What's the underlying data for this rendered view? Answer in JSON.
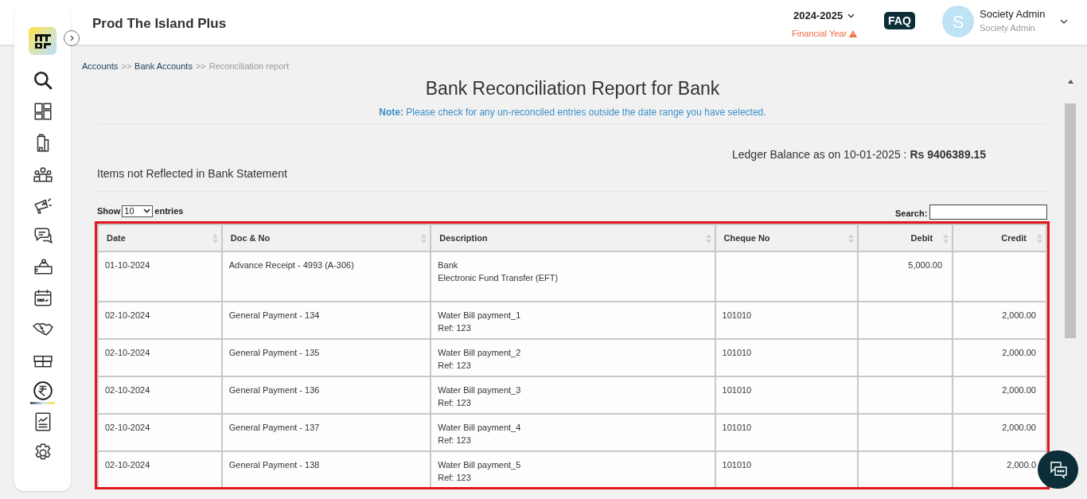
{
  "header": {
    "title": "Prod The Island Plus",
    "year": "2024-2025",
    "year_label": "Financial Year",
    "faq": "FAQ",
    "avatar": "S",
    "user_name": "Society Admin",
    "user_role": "Society Admin"
  },
  "sidebar": {
    "items": [
      {
        "selected": false
      },
      {
        "selected": false
      },
      {
        "selected": false
      },
      {
        "selected": false
      },
      {
        "selected": false
      },
      {
        "selected": false
      },
      {
        "selected": false
      },
      {
        "selected": false
      },
      {
        "selected": false
      },
      {
        "selected": false
      },
      {
        "selected": true
      },
      {
        "selected": false
      },
      {
        "selected": false
      }
    ]
  },
  "breadcrumb": [
    {
      "label": "Accounts",
      "link": true
    },
    {
      "label": "Bank Accounts",
      "link": true
    },
    {
      "label": "Reconciliation report",
      "link": false
    }
  ],
  "breadcrumb_sep": ">>",
  "report": {
    "title": "Bank Reconciliation Report for Bank",
    "note_label": "Note:",
    "note": "Please check for any un-reconciled entries outside the date range you have selected.",
    "balance_label": "Ledger Balance as on 10-01-2025 :",
    "balance": "Rs 9406389.15",
    "section": "Items not Reflected in Bank Statement"
  },
  "table_controls": {
    "show": "Show",
    "entries_value": "10",
    "entries": "entries",
    "search": "Search:"
  },
  "table": {
    "columns": [
      "Date",
      "Doc & No",
      "Description",
      "Cheque No",
      "Debit",
      "Credit"
    ],
    "rows": [
      [
        "01-10-2024",
        "Advance Receipt - 4993 (A-306)",
        [
          "Bank",
          "Electronic Fund Transfer (EFT)"
        ],
        "",
        "5,000.00",
        ""
      ],
      [
        "02-10-2024",
        "General Payment - 134",
        [
          "Water Bill payment_1",
          "Ref: 123"
        ],
        "101010",
        "",
        "2,000.00"
      ],
      [
        "02-10-2024",
        "General Payment - 135",
        [
          "Water Bill payment_2",
          "Ref: 123"
        ],
        "101010",
        "",
        "2,000.00"
      ],
      [
        "02-10-2024",
        "General Payment - 136",
        [
          "Water Bill payment_3",
          "Ref: 123"
        ],
        "101010",
        "",
        "2,000.00"
      ],
      [
        "02-10-2024",
        "General Payment - 137",
        [
          "Water Bill payment_4",
          "Ref: 123"
        ],
        "101010",
        "",
        "2,000.00"
      ],
      [
        "02-10-2024",
        "General Payment - 138",
        [
          "Water Bill payment_5",
          "Ref: 123"
        ],
        "101010",
        "",
        "2,000.0"
      ]
    ]
  }
}
